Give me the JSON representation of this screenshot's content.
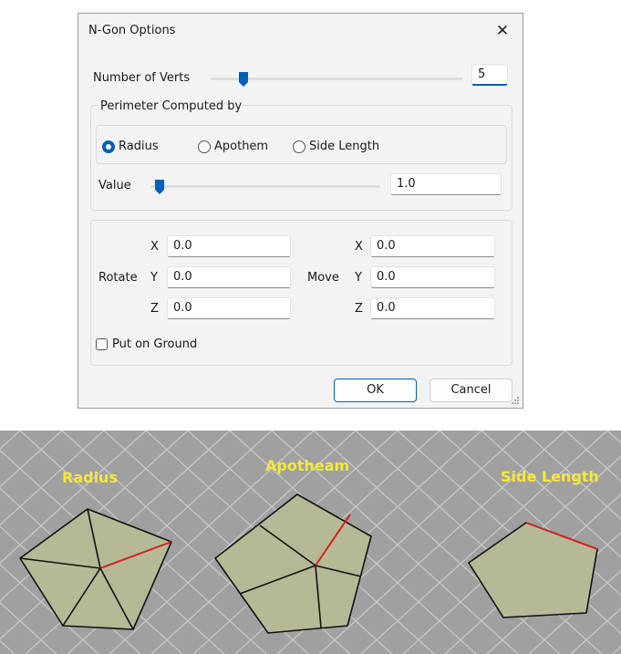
{
  "dialog": {
    "title": "N-Gon Options",
    "close_icon": "close-icon",
    "num_verts": {
      "label": "Number of Verts",
      "value": "5"
    },
    "perimeter": {
      "title": "Perimeter Computed by",
      "options": [
        {
          "label": "Radius",
          "checked": true
        },
        {
          "label": "Apothem",
          "checked": false
        },
        {
          "label": "Side Length",
          "checked": false
        }
      ],
      "value_label": "Value",
      "value": "1.0"
    },
    "transform": {
      "rotate_label": "Rotate",
      "move_label": "Move",
      "axes": [
        "X",
        "Y",
        "Z"
      ],
      "rotate": {
        "x": "0.0",
        "y": "0.0",
        "z": "0.0"
      },
      "move": {
        "x": "0.0",
        "y": "0.0",
        "z": "0.0"
      },
      "put_on_ground": {
        "label": "Put on Ground",
        "checked": false
      }
    },
    "buttons": {
      "ok": "OK",
      "cancel": "Cancel"
    }
  },
  "viewport": {
    "labels": {
      "radius": "Radius",
      "apothem": "Apotheam",
      "side_length": "Side Length"
    },
    "colors": {
      "background": "#a0a0a0",
      "grid": "#c8c8c8",
      "face": "#b5b996",
      "edge": "#111111",
      "highlight": "#d42020",
      "label": "#f6e83a"
    }
  },
  "colors": {
    "accent": "#005fb8",
    "dialog_bg": "#f3f3f3"
  }
}
